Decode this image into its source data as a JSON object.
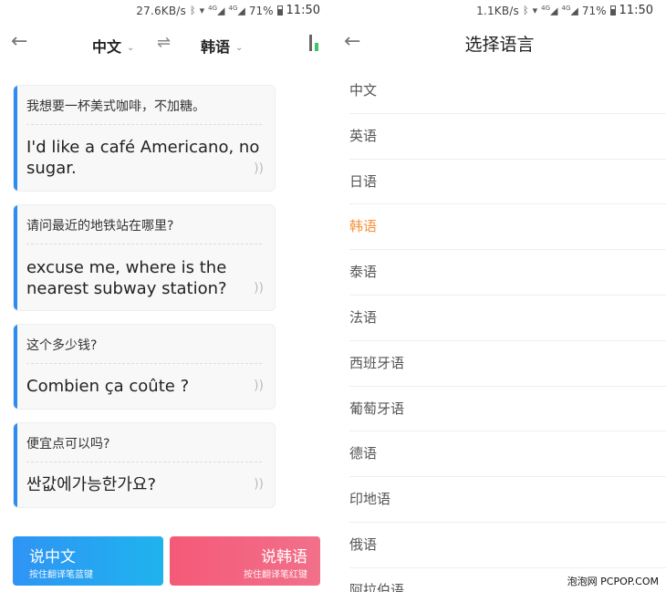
{
  "left": {
    "status": {
      "net": "27.6KB/s",
      "signal_a": "4G",
      "signal_b": "4G",
      "battery": "71%",
      "time": "11:50"
    },
    "header": {
      "source_lang": "中文",
      "target_lang": "韩语",
      "swap_symbol": "⇌"
    },
    "cards": [
      {
        "source": "我想要一杯美式咖啡，不加糖。",
        "translation_line1": "I'd like a café Americano, no",
        "translation_line2": "sugar."
      },
      {
        "source": "请问最近的地铁站在哪里?",
        "translation_line1": "excuse me, where is the",
        "translation_line2": "nearest subway station?"
      },
      {
        "source": "这个多少钱?",
        "translation_line1": "Combien ça coûte ?",
        "translation_line2": ""
      },
      {
        "source": "便宜点可以吗?",
        "translation_line1": "싼값에가능한가요?",
        "translation_line2": ""
      }
    ],
    "speak_buttons": {
      "chinese_label": "说中文",
      "chinese_hint": "按住翻译笔蓝键",
      "korean_label": "说韩语",
      "korean_hint": "按住翻译笔红键"
    }
  },
  "right": {
    "status": {
      "net": "1.1KB/s",
      "signal_a": "4G",
      "signal_b": "4G",
      "battery": "71%",
      "time": "11:50"
    },
    "title": "选择语言",
    "languages": [
      "中文",
      "英语",
      "日语",
      "韩语",
      "泰语",
      "法语",
      "西班牙语",
      "葡萄牙语",
      "德语",
      "印地语",
      "俄语",
      "阿拉伯语"
    ],
    "selected_index": 3,
    "selected_color": "#f7913c"
  },
  "watermark": "泡泡网 PCPOP.COM",
  "colors": {
    "blue_accent": "#2d8cf0",
    "red_accent": "#f45a78"
  }
}
